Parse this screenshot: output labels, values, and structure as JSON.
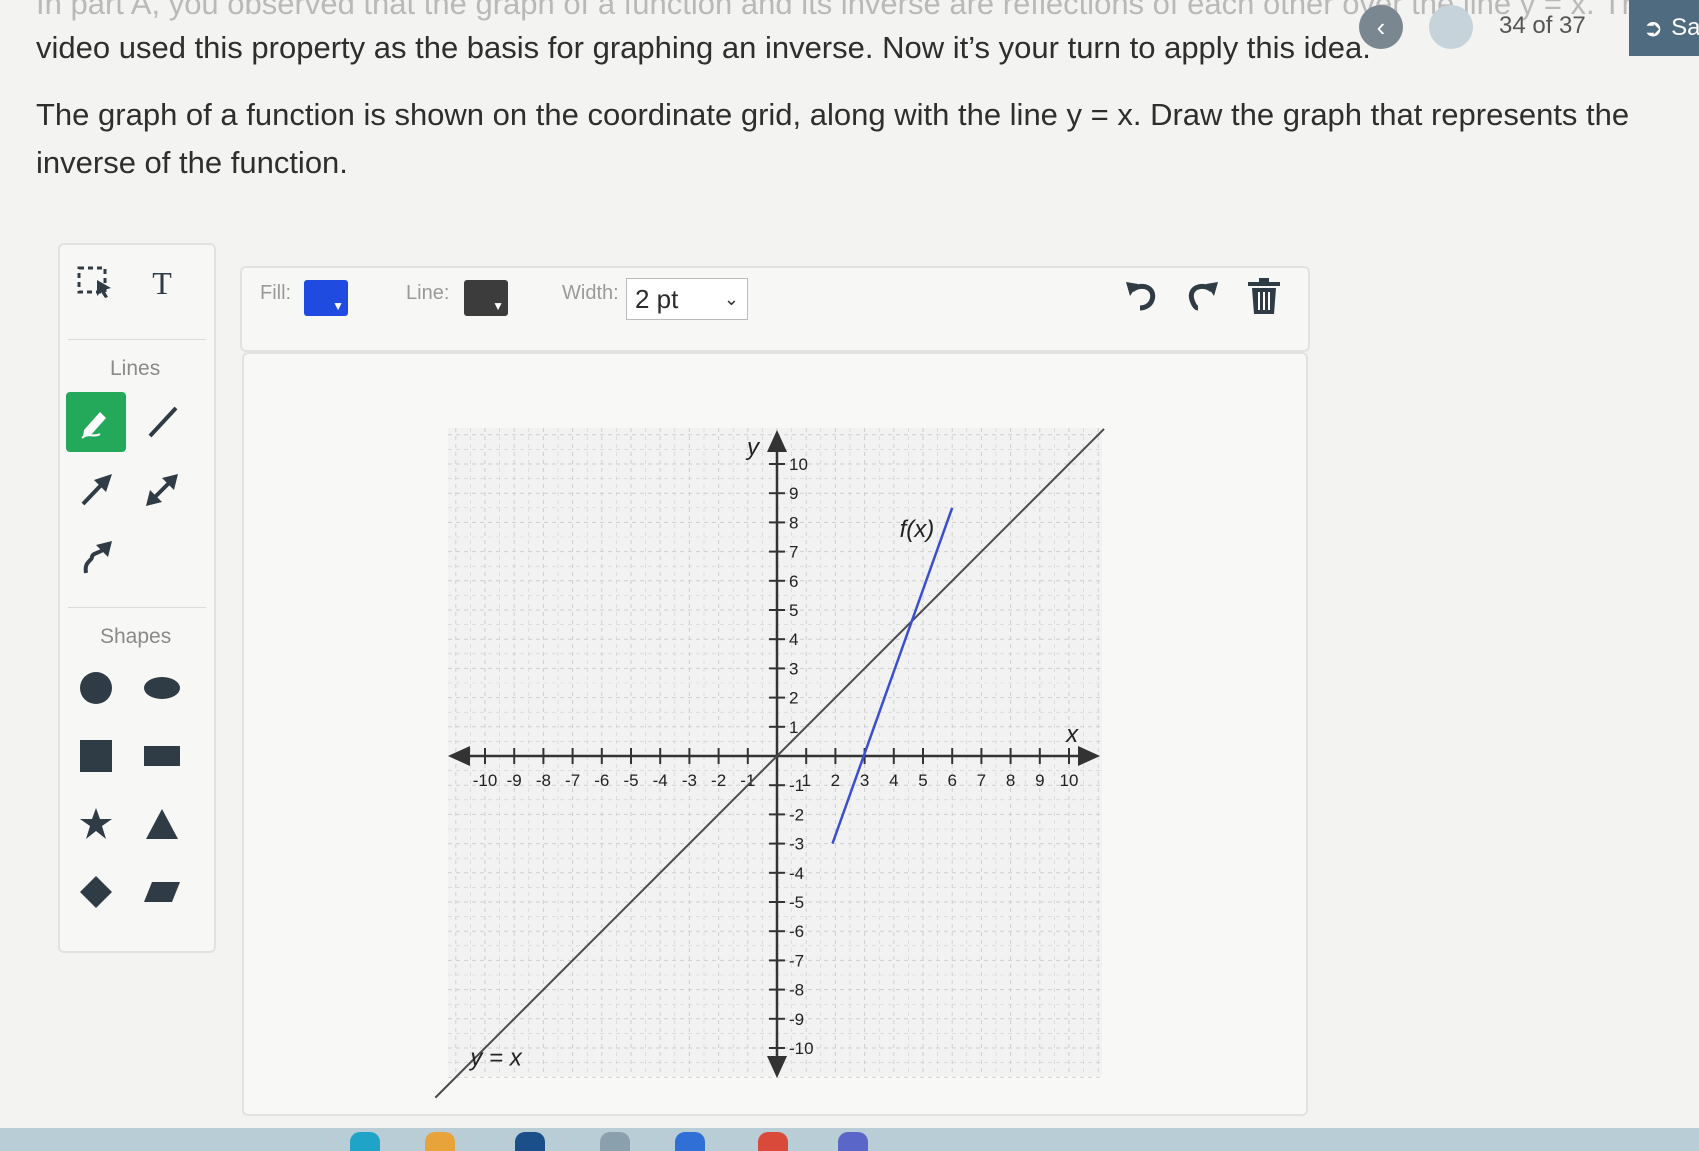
{
  "header": {
    "cut_text": "In part A, you observed that the graph of a function and its inverse are reflections of each other over the line y = x. The",
    "line2": "video used this property as the basis for graphing an inverse. Now it’s your turn to apply this idea.",
    "instruction_line1": "The graph of a function is shown on the coordinate grid, along with the line y = x. Draw the graph that represents the",
    "instruction_line2": "inverse of the function."
  },
  "nav": {
    "back_icon": "chevron-left-icon",
    "counter": "34 of 37",
    "save_label": "Sa"
  },
  "tools": {
    "select_icon": "select-icon",
    "text_label": "T",
    "lines_label": "Lines",
    "shapes_label": "Shapes"
  },
  "toolbar": {
    "fill_label": "Fill:",
    "line_label": "Line:",
    "width_label": "Width:",
    "width_value": "2 pt",
    "fill_color": "#1f4be0",
    "line_color": "#3c3c3c",
    "undo_icon": "undo-icon",
    "redo_icon": "redo-icon",
    "trash_icon": "trash-icon"
  },
  "graph": {
    "x_axis_label": "x",
    "y_axis_label": "y",
    "x_ticks": [
      "-10",
      "-9",
      "-8",
      "-7",
      "-6",
      "-5",
      "-4",
      "-3",
      "-2",
      "-1",
      "1",
      "2",
      "3",
      "4",
      "5",
      "6",
      "7",
      "8",
      "9",
      "10"
    ],
    "y_ticks": [
      "10",
      "9",
      "8",
      "7",
      "6",
      "5",
      "4",
      "3",
      "2",
      "1",
      "-1",
      "-2",
      "-3",
      "-4",
      "-5",
      "-6",
      "-7",
      "-8",
      "-9",
      "-10"
    ],
    "fx_label": "f(x)",
    "yx_label": "y = x",
    "fx_segment": {
      "x1": 1.9,
      "y1": -3.0,
      "x2": 6.0,
      "y2": 8.5
    },
    "yx_segment": {
      "x1": -11,
      "y1": -11,
      "x2": 11,
      "y2": 11
    },
    "colors": {
      "fx": "#3a4fd0",
      "yx": "#4a4a4a",
      "grid": "#c8c8c8"
    }
  }
}
